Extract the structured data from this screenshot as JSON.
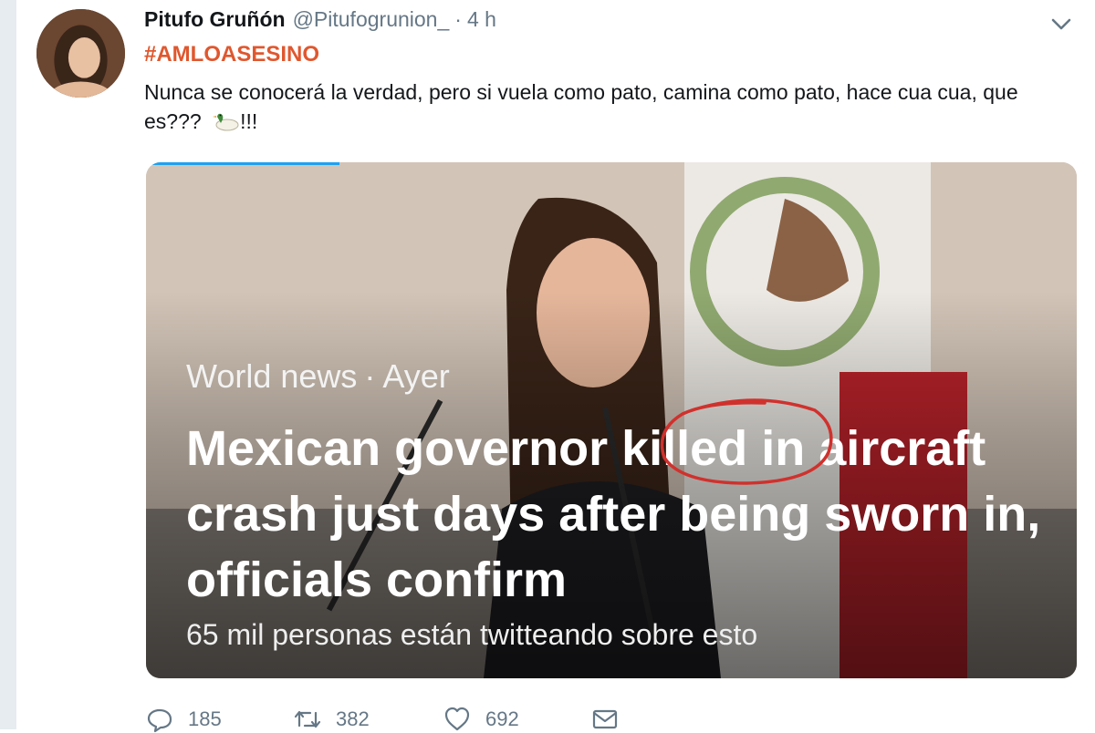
{
  "tweet": {
    "display_name": "Pitufo Gruñón",
    "handle": "@Pitufogrunion_",
    "separator": "·",
    "time": "4 h",
    "hashtag": "#AMLOASESINO",
    "text": "Nunca se conocerá la verdad, pero si vuela como pato, camina como pato, hace cua cua, que es???",
    "text_suffix": "!!!",
    "emoji": "duck-emoji"
  },
  "card": {
    "source": "World news",
    "separator": "·",
    "date": "Ayer",
    "headline": "Mexican governor killed in aircraft crash just days after being sworn in, officials confirm",
    "subtext": "65 mil personas están twitteando sobre esto",
    "highlight_word": "killed",
    "highlight_color": "#d0312d"
  },
  "actions": {
    "reply_count": "185",
    "retweet_count": "382",
    "like_count": "692"
  },
  "colors": {
    "hashtag": "#e0572e",
    "meta_text": "#657786",
    "accent": "#1da1f2"
  }
}
